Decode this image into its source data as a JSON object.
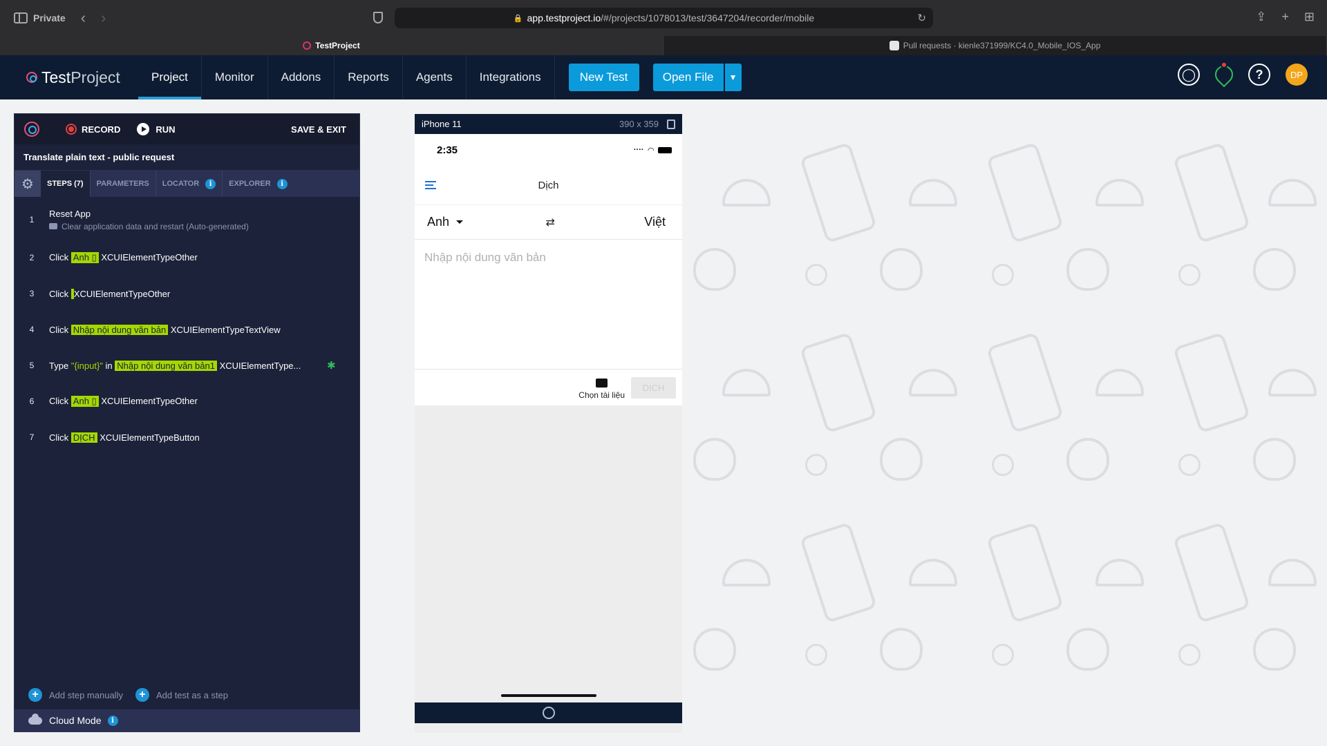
{
  "browser": {
    "private_label": "Private",
    "url_host": "app.testproject.io",
    "url_path": "/#/projects/1078013/test/3647204/recorder/mobile",
    "tabs": [
      {
        "label": "TestProject"
      },
      {
        "label": "Pull requests · kienle371999/KC4.0_Mobile_IOS_App"
      }
    ]
  },
  "nav": {
    "logo_test": "Test",
    "logo_project": "Project",
    "items": [
      {
        "label": "Project"
      },
      {
        "label": "Monitor"
      },
      {
        "label": "Addons"
      },
      {
        "label": "Reports"
      },
      {
        "label": "Agents"
      },
      {
        "label": "Integrations"
      }
    ],
    "new_test": "New Test",
    "open_file": "Open File",
    "avatar_initials": "DP"
  },
  "recorder": {
    "record_label": "RECORD",
    "run_label": "RUN",
    "save_exit_label": "SAVE & EXIT",
    "test_title": "Translate plain text - public request",
    "tabs": [
      {
        "label": "STEPS (7)"
      },
      {
        "label": "PARAMETERS"
      },
      {
        "label": "LOCATOR"
      },
      {
        "label": "EXPLORER"
      }
    ],
    "steps": [
      {
        "num": "1",
        "action": "Reset App",
        "comment": "Clear application data and restart (Auto-generated)"
      },
      {
        "num": "2",
        "action": "Click",
        "target": "Anh ▯",
        "element": "XCUIElementTypeOther"
      },
      {
        "num": "3",
        "action": "Click",
        "target": "",
        "element": "XCUIElementTypeOther"
      },
      {
        "num": "4",
        "action": "Click",
        "target": "Nhập nội dung văn bản",
        "element": "XCUIElementTypeTextView"
      },
      {
        "num": "5",
        "action": "Type",
        "value": "\"{input}\"",
        "in_word": "in",
        "target": "Nhập nội dung văn bản1",
        "element": "XCUIElementType..."
      },
      {
        "num": "6",
        "action": "Click",
        "target": "Anh ▯",
        "element": "XCUIElementTypeOther"
      },
      {
        "num": "7",
        "action": "Click",
        "target": "DỊCH",
        "element": "XCUIElementTypeButton"
      }
    ],
    "add_step_manually": "Add step manually",
    "add_test_as_step": "Add test as a step",
    "cloud_mode": "Cloud Mode"
  },
  "device": {
    "model": "iPhone 11",
    "dimensions": "390 x 359",
    "time": "2:35",
    "app_title": "Dịch",
    "source_lang": "Anh",
    "target_lang": "Việt",
    "swap_glyph": "⇄",
    "text_placeholder": "Nhập nội dung văn bản",
    "choose_doc": "Chọn tài liệu",
    "translate_btn": "DỊCH"
  }
}
